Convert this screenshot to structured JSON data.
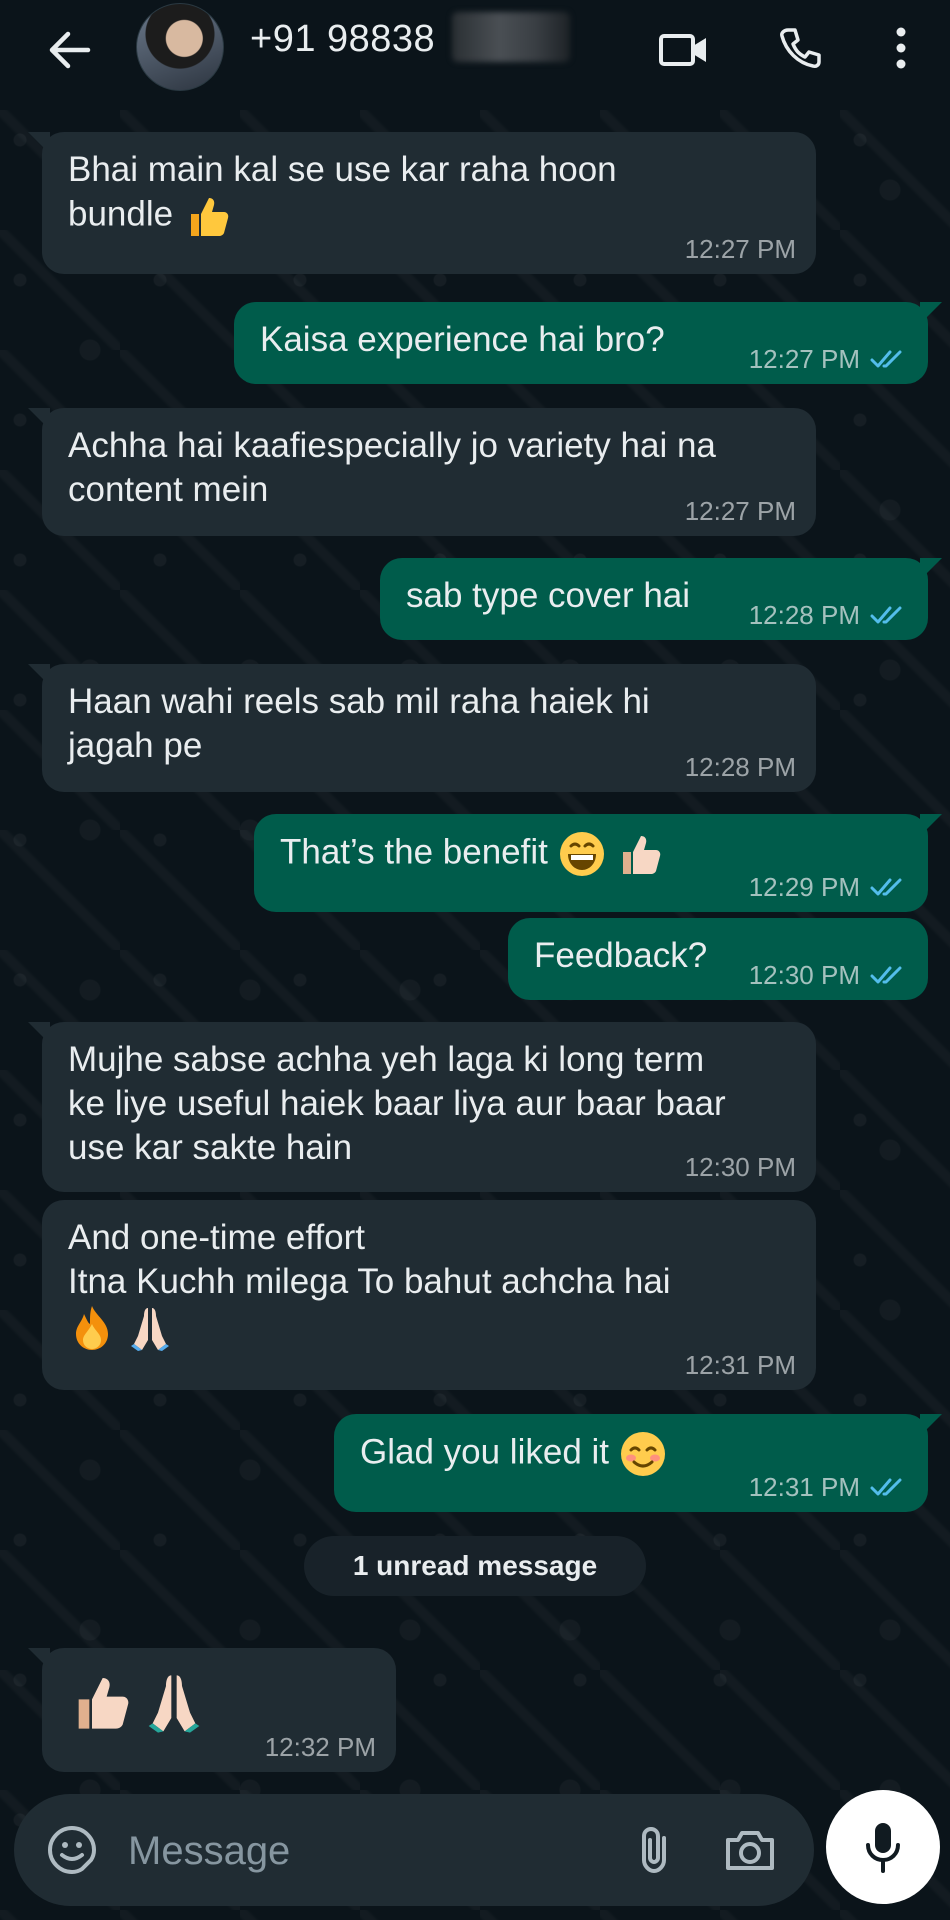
{
  "header": {
    "contact_name": "+91 98838",
    "icons": [
      "back-arrow-icon",
      "video-call-icon",
      "voice-call-icon",
      "more-options-icon"
    ]
  },
  "messages": [
    {
      "direction": "in",
      "text": "Bhai main kal se use kar raha hoon\nbundle",
      "emojis": [
        "thumbs-up"
      ],
      "time": "12:27 PM"
    },
    {
      "direction": "out",
      "text": "Kaisa experience hai bro?",
      "emojis": [],
      "time": "12:27 PM",
      "status": "read"
    },
    {
      "direction": "in",
      "text": "Achha hai kaafiespecially jo variety hai na\ncontent mein",
      "emojis": [],
      "time": "12:27 PM"
    },
    {
      "direction": "out",
      "text": "sab type cover hai",
      "emojis": [],
      "time": "12:28 PM",
      "status": "read"
    },
    {
      "direction": "in",
      "text": "Haan wahi reels sab mil raha haiek hi\njagah pe",
      "emojis": [],
      "time": "12:28 PM"
    },
    {
      "direction": "out",
      "text": "That’s the benefit",
      "emojis": [
        "grinning-face",
        "thumbs-up"
      ],
      "time": "12:29 PM",
      "status": "read"
    },
    {
      "direction": "out",
      "text": "Feedback?",
      "emojis": [],
      "time": "12:30 PM",
      "status": "read"
    },
    {
      "direction": "in",
      "text": "Mujhe sabse achha yeh laga ki long term\nke liye useful haiek baar liya aur baar baar\nuse kar sakte hain",
      "emojis": [],
      "time": "12:30 PM"
    },
    {
      "direction": "in",
      "text": "And one-time effort\nItna Kuchh milega To bahut achcha hai",
      "emojis": [
        "fire",
        "folded-hands"
      ],
      "time": "12:31 PM"
    },
    {
      "direction": "out",
      "text": "Glad you liked it",
      "emojis": [
        "smiling-face"
      ],
      "time": "12:31 PM",
      "status": "read"
    },
    {
      "direction": "in",
      "text": "",
      "emojis": [
        "thumbs-up",
        "folded-hands"
      ],
      "time": "12:32 PM"
    }
  ],
  "unread_label": "1 unread message",
  "composer": {
    "placeholder": "Message",
    "icons": [
      "emoji-sticker-icon",
      "attach-icon",
      "camera-icon",
      "mic-icon"
    ]
  },
  "colors": {
    "background": "#0b141a",
    "incoming_bubble": "#202c33",
    "outgoing_bubble": "#005c4b",
    "read_tick": "#53bdeb"
  }
}
